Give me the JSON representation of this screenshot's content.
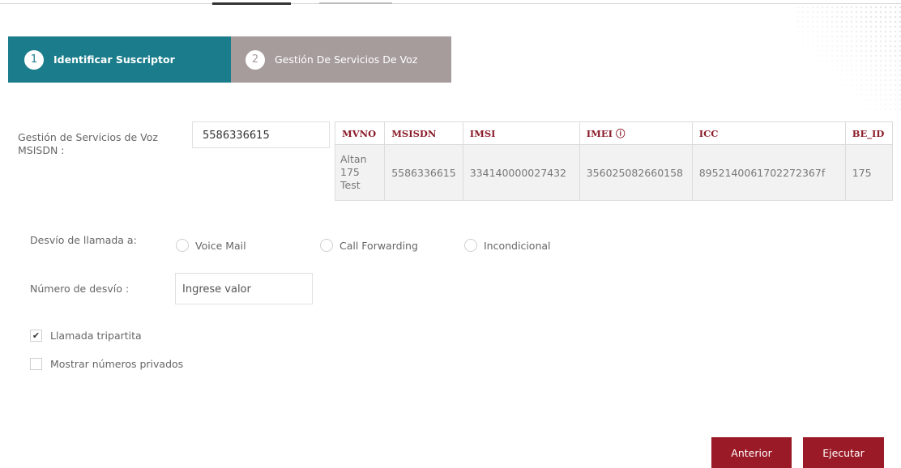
{
  "steps": [
    {
      "number": "1",
      "label": "Identificar Suscriptor"
    },
    {
      "number": "2",
      "label": "Gestión De Servicios De Voz"
    }
  ],
  "msisdn": {
    "label_line1": "Gestión de Servicios de Voz",
    "label_line2": "MSISDN :",
    "value": "5586336615"
  },
  "table": {
    "headers": {
      "mvno": "MVNO",
      "msisdn": "MSISDN",
      "imsi": "IMSI",
      "imei": "IMEI ⓘ",
      "icc": "ICC",
      "be_id": "BE_ID"
    },
    "row": {
      "mvno_line1": "Altan",
      "mvno_line2": "175",
      "mvno_line3": "Test",
      "msisdn": "5586336615",
      "imsi": "334140000027432",
      "imei": "356025082660158",
      "icc": "8952140061702272367f",
      "be_id": "175"
    }
  },
  "desvio": {
    "label": "Desvío de llamada a:",
    "options": [
      "Voice Mail",
      "Call Forwarding",
      "Incondicional"
    ]
  },
  "numero_desvio": {
    "label": "Número de desvío :",
    "placeholder": "Ingrese valor"
  },
  "checkboxes": [
    {
      "label": "Llamada tripartita",
      "checked": true
    },
    {
      "label": "Mostrar números privados",
      "checked": false
    }
  ],
  "buttons": {
    "anterior": "Anterior",
    "ejecutar": "Ejecutar"
  },
  "colors": {
    "step_active": "#1b7d8c",
    "step_inactive": "#a69c9c",
    "primary_button": "#9a1b27",
    "table_header_text": "#8b1d2a"
  }
}
